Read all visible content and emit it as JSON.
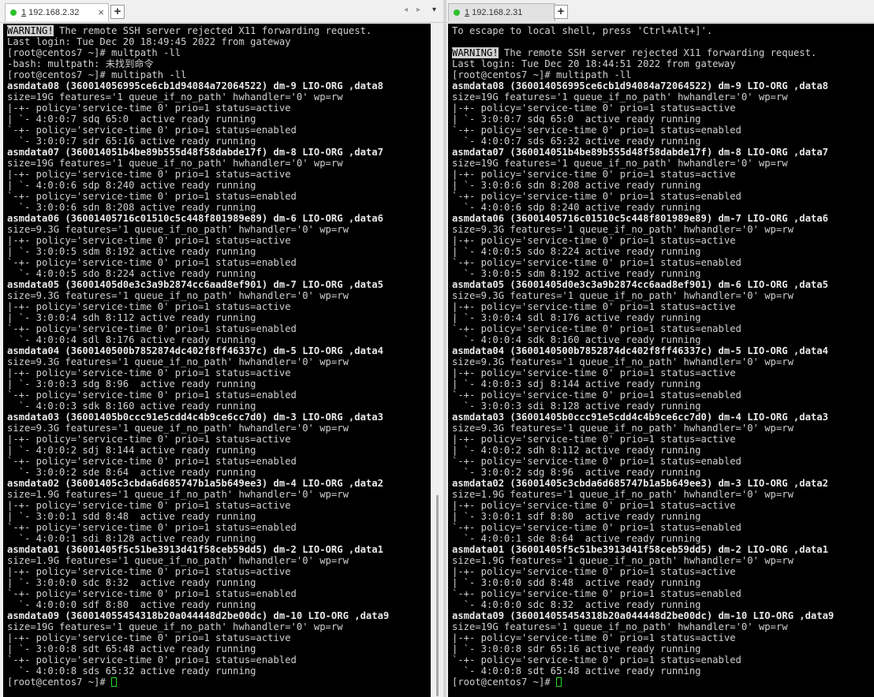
{
  "left_pane": {
    "tab": {
      "label_prefix": "1",
      "label": " 192.168.2.32",
      "close": "×"
    },
    "add_tab": "+",
    "nav_prev": "◂",
    "nav_next": "▸",
    "nav_menu": "▾",
    "lines": [
      [
        "inv:WARNING!",
        " The remote SSH server rejected X11 forwarding request."
      ],
      [
        "Last login: Tue Dec 20 18:49:45 2022 from gateway"
      ],
      [
        "[root@centos7 ~]# multpath -ll"
      ],
      [
        "-bash: multpath: 未找到命令"
      ],
      [
        "[root@centos7 ~]# multipath -ll"
      ],
      [
        "b:asmdata08 (360014056995ce6cb1d94084a72064522) dm-9 LIO-ORG ,data8"
      ],
      [
        "size=19G features='1 queue_if_no_path' hwhandler='0' wp=rw"
      ],
      [
        "|-+- policy='service-time 0' prio=1 status=active"
      ],
      [
        "| `- 4:0:0:7 sdq 65:0  active ready running"
      ],
      [
        "`-+- policy='service-time 0' prio=1 status=enabled"
      ],
      [
        "  `- 3:0:0:7 sdr 65:16 active ready running"
      ],
      [
        "b:asmdata07 (360014051b4be89b555d48f58dabde17f) dm-8 LIO-ORG ,data7"
      ],
      [
        "size=19G features='1 queue_if_no_path' hwhandler='0' wp=rw"
      ],
      [
        "|-+- policy='service-time 0' prio=1 status=active"
      ],
      [
        "| `- 4:0:0:6 sdp 8:240 active ready running"
      ],
      [
        "`-+- policy='service-time 0' prio=1 status=enabled"
      ],
      [
        "  `- 3:0:0:6 sdn 8:208 active ready running"
      ],
      [
        "b:asmdata06 (36001405716c01510c5c448f801989e89) dm-6 LIO-ORG ,data6"
      ],
      [
        "size=9.3G features='1 queue_if_no_path' hwhandler='0' wp=rw"
      ],
      [
        "|-+- policy='service-time 0' prio=1 status=active"
      ],
      [
        "| `- 3:0:0:5 sdm 8:192 active ready running"
      ],
      [
        "`-+- policy='service-time 0' prio=1 status=enabled"
      ],
      [
        "  `- 4:0:0:5 sdo 8:224 active ready running"
      ],
      [
        "b:asmdata05 (36001405d0e3c3a9b2874cc6aad8ef901) dm-7 LIO-ORG ,data5"
      ],
      [
        "size=9.3G features='1 queue_if_no_path' hwhandler='0' wp=rw"
      ],
      [
        "|-+- policy='service-time 0' prio=1 status=active"
      ],
      [
        "| `- 3:0:0:4 sdh 8:112 active ready running"
      ],
      [
        "`-+- policy='service-time 0' prio=1 status=enabled"
      ],
      [
        "  `- 4:0:0:4 sdl 8:176 active ready running"
      ],
      [
        "b:asmdata04 (3600140500b7852874dc402f8ff46337c) dm-5 LIO-ORG ,data4"
      ],
      [
        "size=9.3G features='1 queue_if_no_path' hwhandler='0' wp=rw"
      ],
      [
        "|-+- policy='service-time 0' prio=1 status=active"
      ],
      [
        "| `- 3:0:0:3 sdg 8:96  active ready running"
      ],
      [
        "`-+- policy='service-time 0' prio=1 status=enabled"
      ],
      [
        "  `- 4:0:0:3 sdk 8:160 active ready running"
      ],
      [
        "b:asmdata03 (36001405b0ccc91e5cdd4c4b9ce6cc7d0) dm-3 LIO-ORG ,data3"
      ],
      [
        "size=9.3G features='1 queue_if_no_path' hwhandler='0' wp=rw"
      ],
      [
        "|-+- policy='service-time 0' prio=1 status=active"
      ],
      [
        "| `- 4:0:0:2 sdj 8:144 active ready running"
      ],
      [
        "`-+- policy='service-time 0' prio=1 status=enabled"
      ],
      [
        "  `- 3:0:0:2 sde 8:64  active ready running"
      ],
      [
        "b:asmdata02 (36001405c3cbda6d685747b1a5b649ee3) dm-4 LIO-ORG ,data2"
      ],
      [
        "size=1.9G features='1 queue_if_no_path' hwhandler='0' wp=rw"
      ],
      [
        "|-+- policy='service-time 0' prio=1 status=active"
      ],
      [
        "| `- 3:0:0:1 sdd 8:48  active ready running"
      ],
      [
        "`-+- policy='service-time 0' prio=1 status=enabled"
      ],
      [
        "  `- 4:0:0:1 sdi 8:128 active ready running"
      ],
      [
        "b:asmdata01 (36001405f5c51be3913d41f58ceb59dd5) dm-2 LIO-ORG ,data1"
      ],
      [
        "size=1.9G features='1 queue_if_no_path' hwhandler='0' wp=rw"
      ],
      [
        "|-+- policy='service-time 0' prio=1 status=active"
      ],
      [
        "| `- 3:0:0:0 sdc 8:32  active ready running"
      ],
      [
        "`-+- policy='service-time 0' prio=1 status=enabled"
      ],
      [
        "  `- 4:0:0:0 sdf 8:80  active ready running"
      ],
      [
        "b:asmdata09 (360014055454318b20a044448d2be00dc) dm-10 LIO-ORG ,data9"
      ],
      [
        "size=19G features='1 queue_if_no_path' hwhandler='0' wp=rw"
      ],
      [
        "|-+- policy='service-time 0' prio=1 status=active"
      ],
      [
        "| `- 3:0:0:8 sdt 65:48 active ready running"
      ],
      [
        "`-+- policy='service-time 0' prio=1 status=enabled"
      ],
      [
        "  `- 4:0:0:8 sds 65:32 active ready running"
      ],
      [
        "[root@centos7 ~]# ",
        "cursor:"
      ]
    ]
  },
  "right_pane": {
    "tab": {
      "label_prefix": "1",
      "label": " 192.168.2.31",
      "close": ""
    },
    "add_tab": "+",
    "lines": [
      [
        "To escape to local shell, press 'Ctrl+Alt+]'."
      ],
      [
        ""
      ],
      [
        "inv:WARNING!",
        " The remote SSH server rejected X11 forwarding request."
      ],
      [
        "Last login: Tue Dec 20 18:44:51 2022 from gateway"
      ],
      [
        "[root@centos7 ~]# multipath -ll"
      ],
      [
        "b:asmdata08 (360014056995ce6cb1d94084a72064522) dm-9 LIO-ORG ,data8"
      ],
      [
        "size=19G features='1 queue_if_no_path' hwhandler='0' wp=rw"
      ],
      [
        "|-+- policy='service-time 0' prio=1 status=active"
      ],
      [
        "| `- 3:0:0:7 sdq 65:0  active ready running"
      ],
      [
        "`-+- policy='service-time 0' prio=1 status=enabled"
      ],
      [
        "  `- 4:0:0:7 sds 65:32 active ready running"
      ],
      [
        "b:asmdata07 (360014051b4be89b555d48f58dabde17f) dm-8 LIO-ORG ,data7"
      ],
      [
        "size=19G features='1 queue_if_no_path' hwhandler='0' wp=rw"
      ],
      [
        "|-+- policy='service-time 0' prio=1 status=active"
      ],
      [
        "| `- 3:0:0:6 sdn 8:208 active ready running"
      ],
      [
        "`-+- policy='service-time 0' prio=1 status=enabled"
      ],
      [
        "  `- 4:0:0:6 sdp 8:240 active ready running"
      ],
      [
        "b:asmdata06 (36001405716c01510c5c448f801989e89) dm-7 LIO-ORG ,data6"
      ],
      [
        "size=9.3G features='1 queue_if_no_path' hwhandler='0' wp=rw"
      ],
      [
        "|-+- policy='service-time 0' prio=1 status=active"
      ],
      [
        "| `- 4:0:0:5 sdo 8:224 active ready running"
      ],
      [
        "`-+- policy='service-time 0' prio=1 status=enabled"
      ],
      [
        "  `- 3:0:0:5 sdm 8:192 active ready running"
      ],
      [
        "b:asmdata05 (36001405d0e3c3a9b2874cc6aad8ef901) dm-6 LIO-ORG ,data5"
      ],
      [
        "size=9.3G features='1 queue_if_no_path' hwhandler='0' wp=rw"
      ],
      [
        "|-+- policy='service-time 0' prio=1 status=active"
      ],
      [
        "| `- 3:0:0:4 sdl 8:176 active ready running"
      ],
      [
        "`-+- policy='service-time 0' prio=1 status=enabled"
      ],
      [
        "  `- 4:0:0:4 sdk 8:160 active ready running"
      ],
      [
        "b:asmdata04 (3600140500b7852874dc402f8ff46337c) dm-5 LIO-ORG ,data4"
      ],
      [
        "size=9.3G features='1 queue_if_no_path' hwhandler='0' wp=rw"
      ],
      [
        "|-+- policy='service-time 0' prio=1 status=active"
      ],
      [
        "| `- 4:0:0:3 sdj 8:144 active ready running"
      ],
      [
        "`-+- policy='service-time 0' prio=1 status=enabled"
      ],
      [
        "  `- 3:0:0:3 sdi 8:128 active ready running"
      ],
      [
        "b:asmdata03 (36001405b0ccc91e5cdd4c4b9ce6cc7d0) dm-4 LIO-ORG ,data3"
      ],
      [
        "size=9.3G features='1 queue_if_no_path' hwhandler='0' wp=rw"
      ],
      [
        "|-+- policy='service-time 0' prio=1 status=active"
      ],
      [
        "| `- 4:0:0:2 sdh 8:112 active ready running"
      ],
      [
        "`-+- policy='service-time 0' prio=1 status=enabled"
      ],
      [
        "  `- 3:0:0:2 sdg 8:96  active ready running"
      ],
      [
        "b:asmdata02 (36001405c3cbda6d685747b1a5b649ee3) dm-3 LIO-ORG ,data2"
      ],
      [
        "size=1.9G features='1 queue_if_no_path' hwhandler='0' wp=rw"
      ],
      [
        "|-+- policy='service-time 0' prio=1 status=active"
      ],
      [
        "| `- 3:0:0:1 sdf 8:80  active ready running"
      ],
      [
        "`-+- policy='service-time 0' prio=1 status=enabled"
      ],
      [
        "  `- 4:0:0:1 sde 8:64  active ready running"
      ],
      [
        "b:asmdata01 (36001405f5c51be3913d41f58ceb59dd5) dm-2 LIO-ORG ,data1"
      ],
      [
        "size=1.9G features='1 queue_if_no_path' hwhandler='0' wp=rw"
      ],
      [
        "|-+- policy='service-time 0' prio=1 status=active"
      ],
      [
        "| `- 3:0:0:0 sdd 8:48  active ready running"
      ],
      [
        "`-+- policy='service-time 0' prio=1 status=enabled"
      ],
      [
        "  `- 4:0:0:0 sdc 8:32  active ready running"
      ],
      [
        "b:asmdata09 (360014055454318b20a044448d2be00dc) dm-10 LIO-ORG ,data9"
      ],
      [
        "size=19G features='1 queue_if_no_path' hwhandler='0' wp=rw"
      ],
      [
        "|-+- policy='service-time 0' prio=1 status=active"
      ],
      [
        "| `- 3:0:0:8 sdr 65:16 active ready running"
      ],
      [
        "`-+- policy='service-time 0' prio=1 status=enabled"
      ],
      [
        "  `- 4:0:0:8 sdt 65:48 active ready running"
      ],
      [
        "[root@centos7 ~]# ",
        "cursor:"
      ]
    ]
  }
}
